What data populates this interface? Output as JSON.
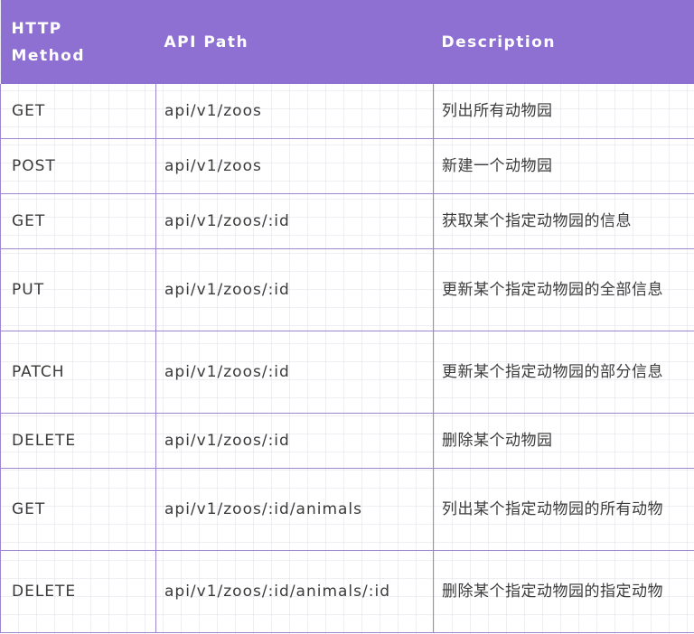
{
  "table": {
    "headers": {
      "method": "HTTP\nMethod",
      "method_line1": "HTTP",
      "method_line2": "Method",
      "path": "API Path",
      "description": "Description"
    },
    "rows": [
      {
        "method": "GET",
        "path": "api/v1/zoos",
        "description": "列出所有动物园"
      },
      {
        "method": "POST",
        "path": "api/v1/zoos",
        "description": "新建一个动物园"
      },
      {
        "method": "GET",
        "path": "api/v1/zoos/:id",
        "description": "获取某个指定动物园的信息"
      },
      {
        "method": "PUT",
        "path": "api/v1/zoos/:id",
        "description": "更新某个指定动物园的全部信息"
      },
      {
        "method": "PATCH",
        "path": "api/v1/zoos/:id",
        "description": "更新某个指定动物园的部分信息"
      },
      {
        "method": "DELETE",
        "path": "api/v1/zoos/:id",
        "description": "删除某个动物园"
      },
      {
        "method": "GET",
        "path": "api/v1/zoos/:id/animals",
        "description": "列出某个指定动物园的所有动物"
      },
      {
        "method": "DELETE",
        "path": "api/v1/zoos/:id/animals/:id",
        "description": "删除某个指定动物园的指定动物"
      }
    ]
  },
  "colors": {
    "header_bg": "#8e6fd2",
    "header_text": "#ffffff",
    "border": "#9b86cf",
    "text": "#3a3a3a"
  }
}
